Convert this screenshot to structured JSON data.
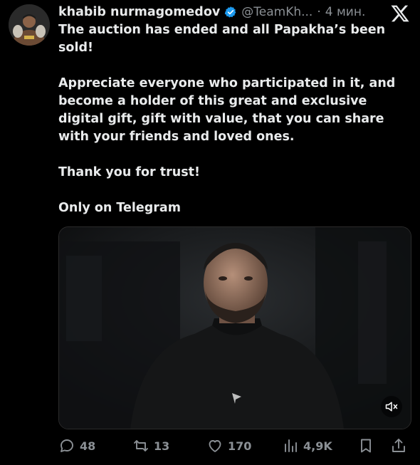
{
  "tweet": {
    "author_name": "khabib nurmagomedov",
    "handle": "@TeamKh...",
    "separator": "·",
    "time": "4 мин.",
    "paragraphs": [
      "The auction has ended and all Papakha’s been sold!",
      "Appreciate everyone who participated in it, and become a holder of this great and exclusive digital gift, gift with  value, that you can share with your friends and loved ones.",
      "Thank you for trust!",
      "Only on Telegram"
    ]
  },
  "actions": {
    "replies": "48",
    "reposts": "13",
    "likes": "170",
    "views": "4,9K"
  },
  "icons": {
    "verified": "verified-badge-icon",
    "logo": "x-logo-icon",
    "reply": "reply-icon",
    "repost": "repost-icon",
    "like": "heart-icon",
    "views": "views-icon",
    "bookmark": "bookmark-icon",
    "share": "share-icon",
    "mute": "muted-speaker-icon",
    "watermark": "telegram-icon"
  },
  "colors": {
    "background": "#000000",
    "text": "#e7e9ea",
    "secondary": "#8b9095",
    "verified": "#1d9bf0"
  }
}
